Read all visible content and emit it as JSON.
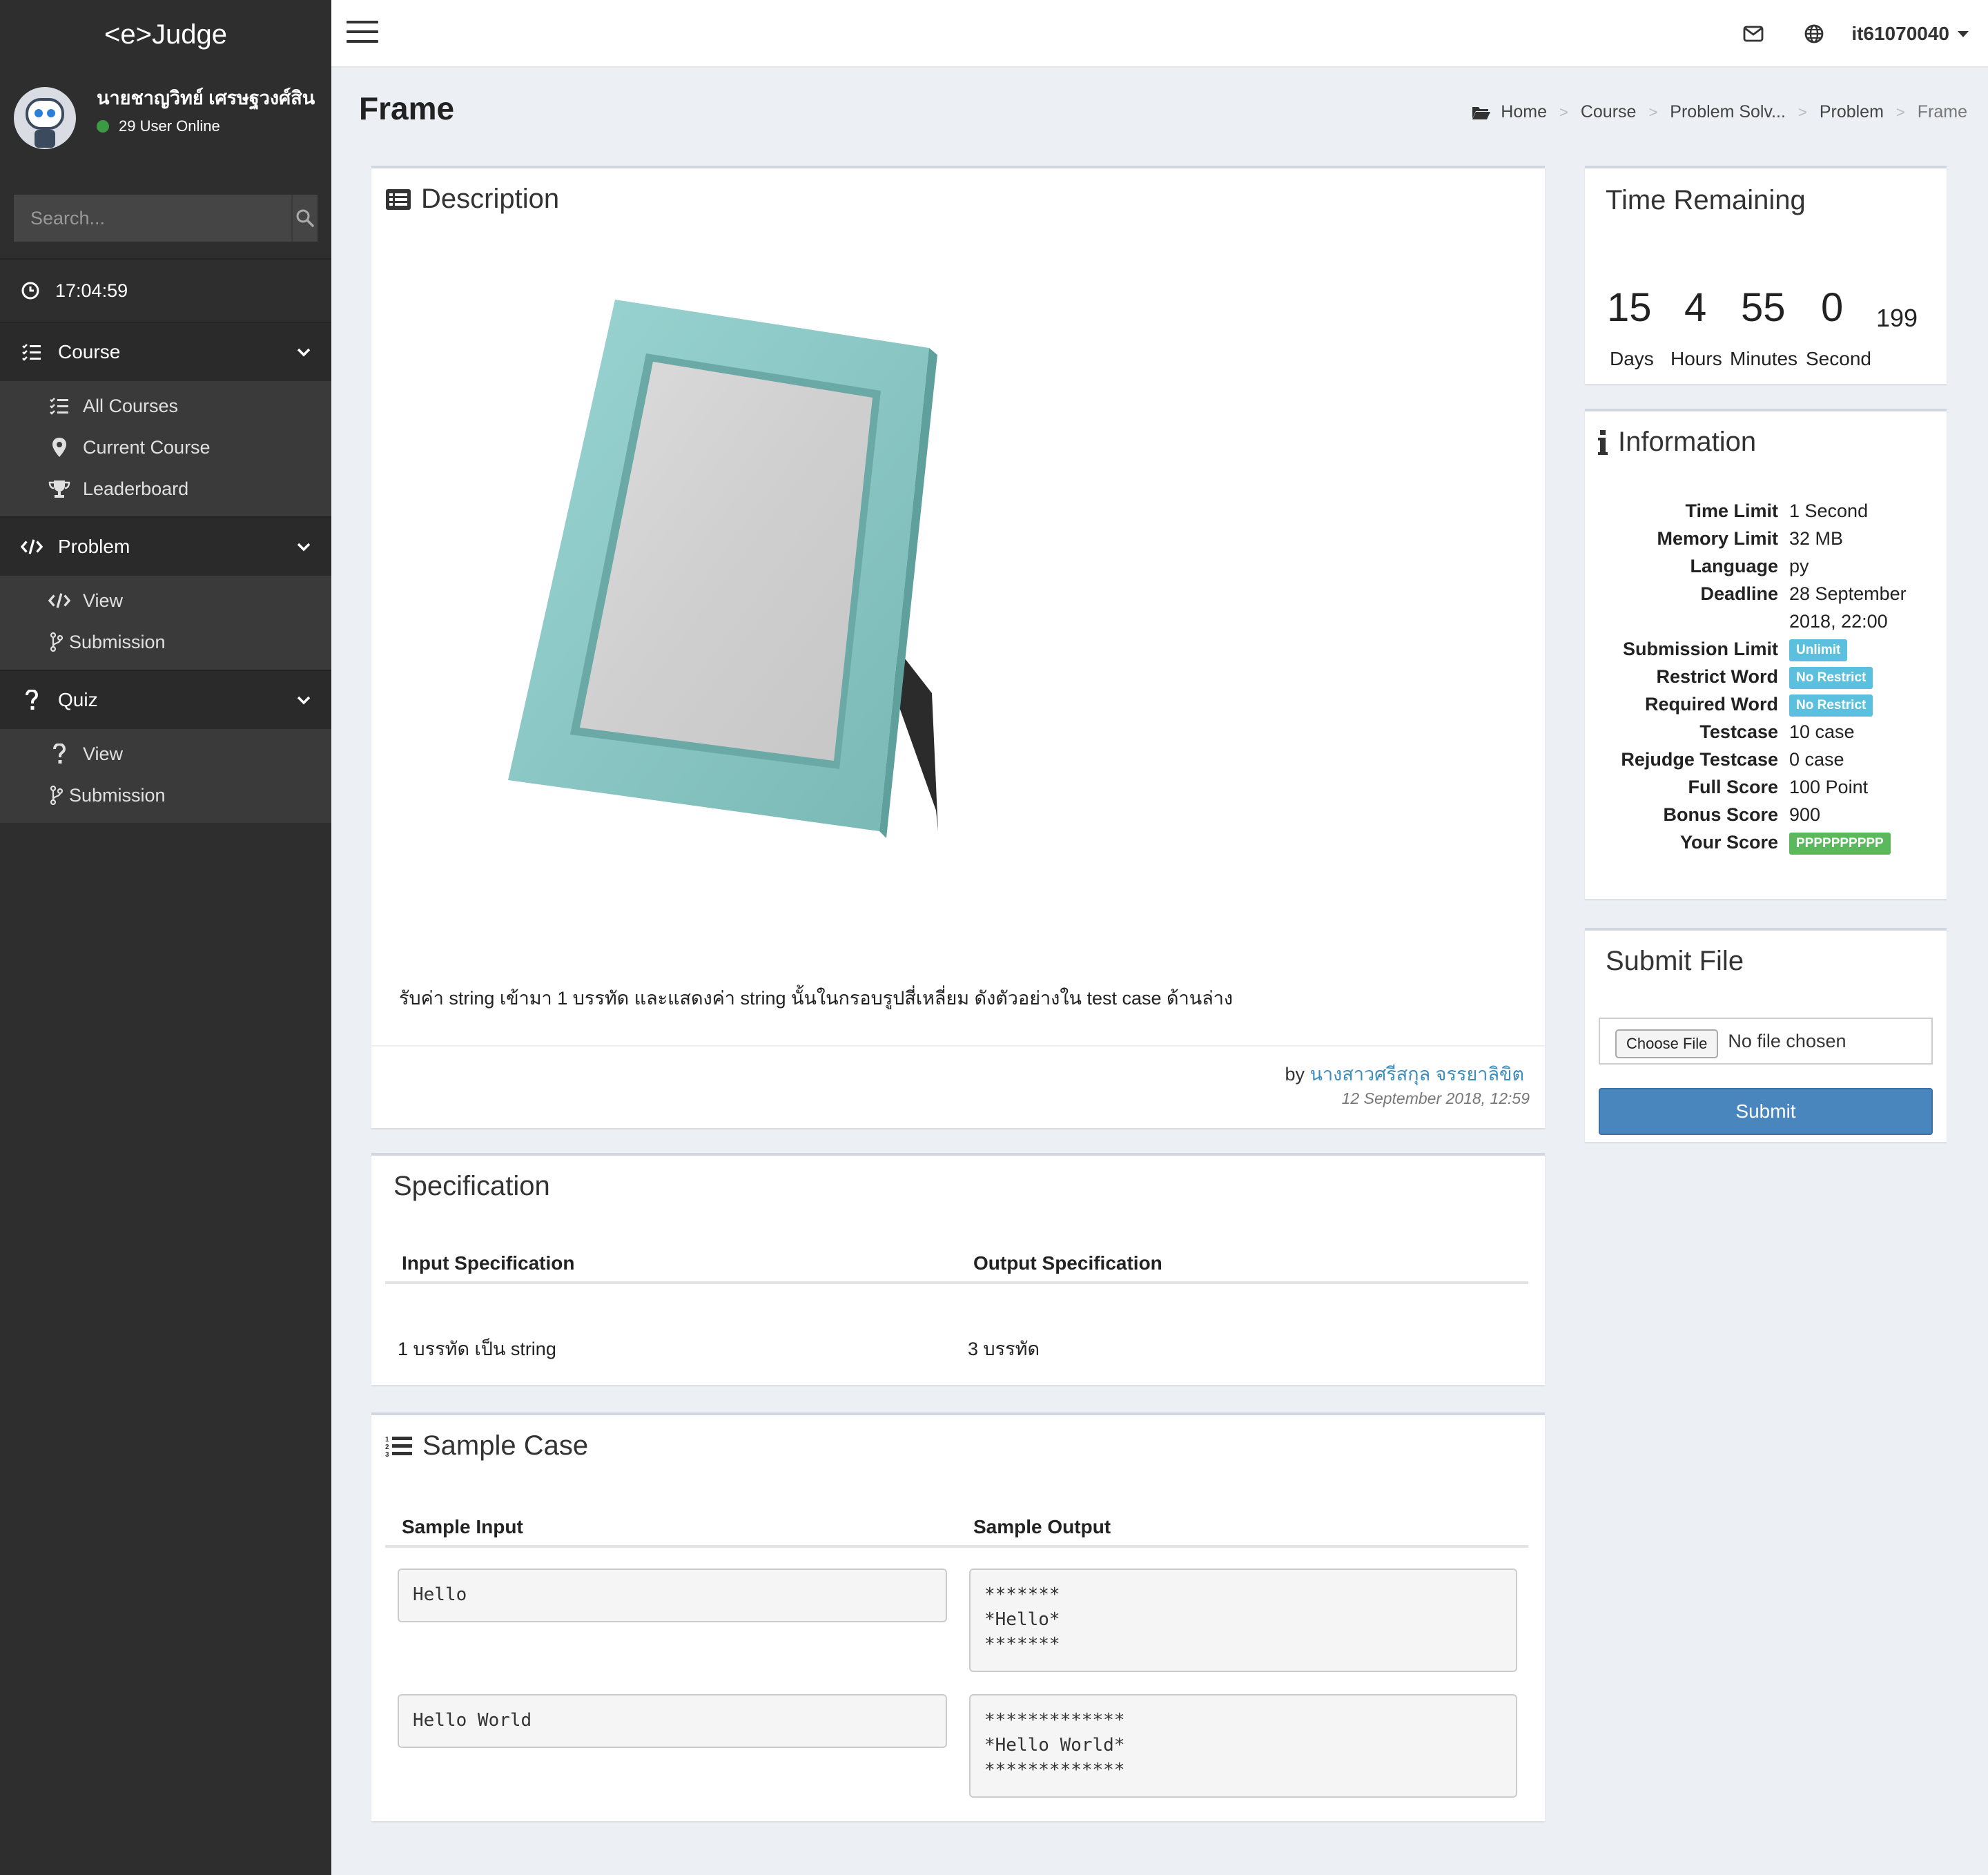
{
  "app": {
    "logo": "<e>Judge"
  },
  "user": {
    "name": "นายชาญวิทย์ เศรษฐวงศ์สิน",
    "online": "29 User Online",
    "username": "it61070040"
  },
  "sidebar": {
    "search_placeholder": "Search...",
    "clock": "17:04:59",
    "course": {
      "label": "Course",
      "items": [
        {
          "label": "All Courses"
        },
        {
          "label": "Current Course"
        },
        {
          "label": "Leaderboard"
        }
      ]
    },
    "problem": {
      "label": "Problem",
      "items": [
        {
          "label": "View"
        },
        {
          "label": "Submission"
        }
      ]
    },
    "quiz": {
      "label": "Quiz",
      "items": [
        {
          "label": "View"
        },
        {
          "label": "Submission"
        }
      ]
    }
  },
  "page": {
    "title": "Frame",
    "breadcrumb": [
      "Home",
      "Course",
      "Problem Solv...",
      "Problem",
      "Frame"
    ]
  },
  "description": {
    "title": "Description",
    "text": "รับค่า string เข้ามา 1 บรรทัด และแสดงค่า string นั้นในกรอบรูปสี่เหลี่ยม ดังตัวอย่างใน test case ด้านล่าง",
    "by": "by",
    "author": "นางสาวศรีสกุล จรรยาลิขิต",
    "date": "12 September 2018, 12:59"
  },
  "specification": {
    "title": "Specification",
    "input_header": "Input Specification",
    "output_header": "Output Specification",
    "input_value": "1 บรรทัด เป็น string",
    "output_value": "3 บรรทัด"
  },
  "sample_case": {
    "title": "Sample Case",
    "input_header": "Sample Input",
    "output_header": "Sample Output",
    "cases": [
      {
        "input": "Hello",
        "output": "*******\n*Hello*\n*******"
      },
      {
        "input": "Hello World",
        "output": "*************\n*Hello World*\n*************"
      }
    ]
  },
  "time_remaining": {
    "title": "Time Remaining",
    "days": "15",
    "days_label": "Days",
    "hours": "4",
    "hours_label": "Hours",
    "minutes": "55",
    "minutes_label": "Minutes",
    "seconds": "0",
    "seconds_label": "Second",
    "millis": "199"
  },
  "information": {
    "title": "Information",
    "rows": {
      "time_limit": {
        "key": "Time Limit",
        "value": "1 Second"
      },
      "memory_limit": {
        "key": "Memory Limit",
        "value": "32 MB"
      },
      "language": {
        "key": "Language",
        "value": "py"
      },
      "deadline": {
        "key": "Deadline",
        "value": "28 September",
        "value2": "2018, 22:00"
      },
      "submission_limit": {
        "key": "Submission Limit",
        "value": "Unlimit"
      },
      "restrict_word": {
        "key": "Restrict Word",
        "value": "No Restrict"
      },
      "required_word": {
        "key": "Required Word",
        "value": "No Restrict"
      },
      "testcase": {
        "key": "Testcase",
        "value": "10 case"
      },
      "rejudge_testcase": {
        "key": "Rejudge Testcase",
        "value": "0 case"
      },
      "full_score": {
        "key": "Full Score",
        "value": "100 Point"
      },
      "bonus_score": {
        "key": "Bonus Score",
        "value": "900"
      },
      "your_score": {
        "key": "Your Score",
        "value": "PPPPPPPPPP"
      }
    },
    "colors": {
      "info_label": "#5bc0de",
      "success_label": "#5cb85c"
    }
  },
  "submit_file": {
    "title": "Submit File",
    "choose_label": "Choose File",
    "no_file": "No file chosen",
    "submit_label": "Submit"
  },
  "icons": [
    "mail-icon",
    "globe-icon",
    "search-icon",
    "clock-icon",
    "list-check-icon",
    "map-marker-icon",
    "trophy-icon",
    "code-icon",
    "code-branch-icon",
    "question-icon",
    "folder-open-icon",
    "list-alt-icon",
    "info-icon",
    "list-ol-icon"
  ],
  "colors": {
    "sidebar_bg": "#2e2e2e",
    "accent_blue": "#4986bd",
    "link": "#3c8dbc"
  }
}
